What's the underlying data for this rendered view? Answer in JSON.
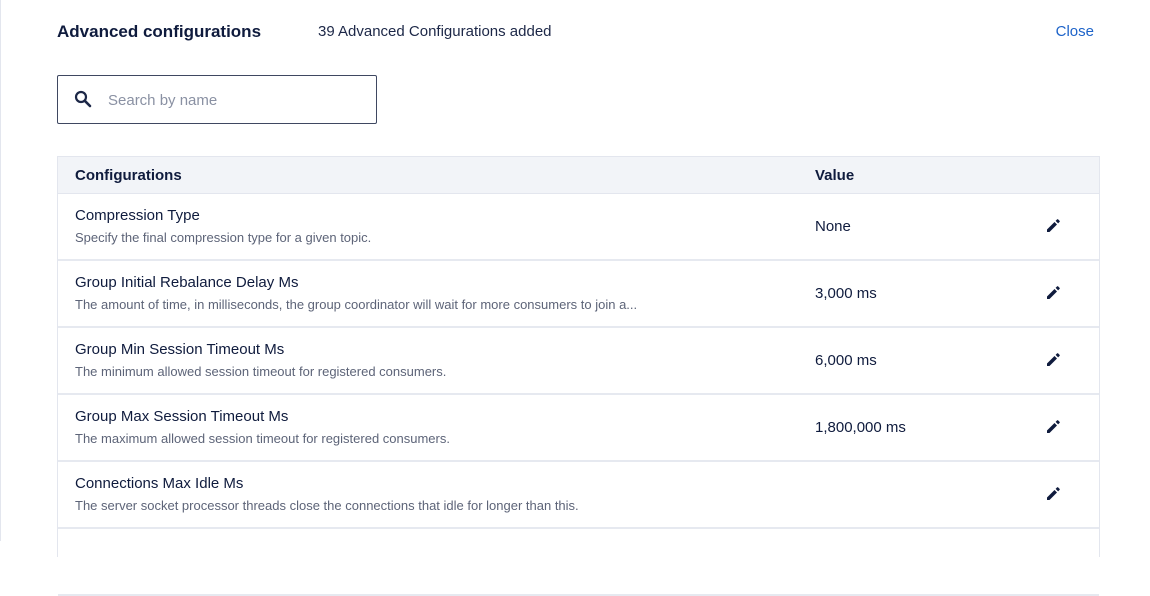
{
  "header": {
    "title": "Advanced configurations",
    "count_text": "39 Advanced Configurations added",
    "close_label": "Close"
  },
  "search": {
    "placeholder": "Search by name",
    "value": ""
  },
  "icons": {
    "search": "search-icon",
    "edit": "pencil-icon"
  },
  "colors": {
    "accent": "#1d63c9",
    "text": "#0f1b3d"
  },
  "table": {
    "columns": [
      "Configurations",
      "Value"
    ],
    "rows": [
      {
        "name": "Compression Type",
        "description": "Specify the final compression type for a given topic.",
        "value": "None"
      },
      {
        "name": "Group Initial Rebalance Delay Ms",
        "description": "The amount of time, in milliseconds, the group coordinator will wait for more consumers to join a...",
        "value": "3,000 ms"
      },
      {
        "name": "Group Min Session Timeout Ms",
        "description": "The minimum allowed session timeout for registered consumers.",
        "value": "6,000 ms"
      },
      {
        "name": "Group Max Session Timeout Ms",
        "description": "The maximum allowed session timeout for registered consumers.",
        "value": "1,800,000 ms"
      },
      {
        "name": "Connections Max Idle Ms",
        "description": "The server socket processor threads close the connections that idle for longer than this.",
        "value": ""
      }
    ]
  }
}
